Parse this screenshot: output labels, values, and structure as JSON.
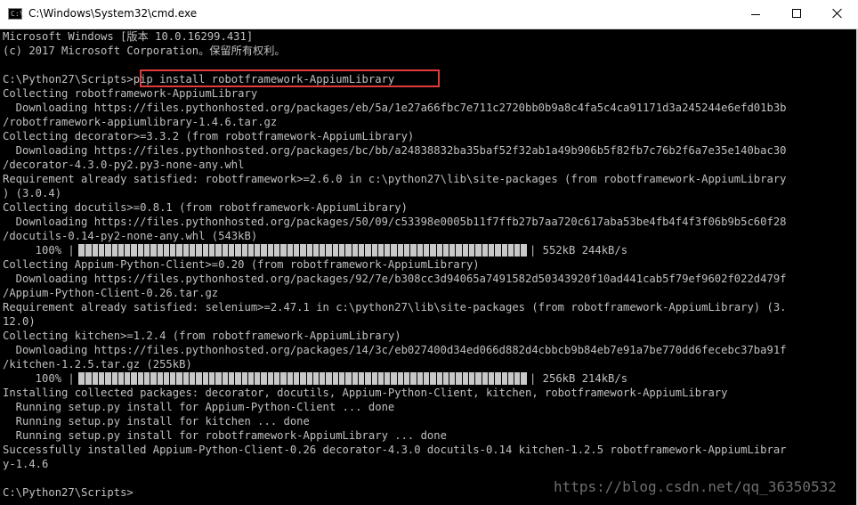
{
  "window": {
    "title": "C:\\Windows\\System32\\cmd.exe",
    "icon_text": "C:\\",
    "controls": [
      "minimize-icon",
      "maximize-icon",
      "close-icon"
    ]
  },
  "console": {
    "lines": [
      "Microsoft Windows [版本 10.0.16299.431]",
      "(c) 2017 Microsoft Corporation。保留所有权利。",
      "",
      "C:\\Python27\\Scripts>pip install robotframework-AppiumLibrary",
      "Collecting robotframework-AppiumLibrary",
      "  Downloading https://files.pythonhosted.org/packages/eb/5a/1e27a66fbc7e711c2720bb0b9a8c4fa5c4ca91171d3a245244e6efd01b3b",
      "/robotframework-appiumlibrary-1.4.6.tar.gz",
      "Collecting decorator>=3.3.2 (from robotframework-AppiumLibrary)",
      "  Downloading https://files.pythonhosted.org/packages/bc/bb/a24838832ba35baf52f32ab1a49b906b5f82fb7c76b2f6a7e35e140bac30",
      "/decorator-4.3.0-py2.py3-none-any.whl",
      "Requirement already satisfied: robotframework>=2.6.0 in c:\\python27\\lib\\site-packages (from robotframework-AppiumLibrary",
      ") (3.0.4)",
      "Collecting docutils>=0.8.1 (from robotframework-AppiumLibrary)",
      "  Downloading https://files.pythonhosted.org/packages/50/09/c53398e0005b11f7ffb27b7aa720c617aba53be4fb4f4f3f06b9b5c60f28",
      "/docutils-0.14-py2-none-any.whl (543kB)",
      "     100% |",
      "Collecting Appium-Python-Client>=0.20 (from robotframework-AppiumLibrary)",
      "  Downloading https://files.pythonhosted.org/packages/92/7e/b308cc3d94065a7491582d50343920f10ad441cab5f79ef9602f022d479f",
      "/Appium-Python-Client-0.26.tar.gz",
      "Requirement already satisfied: selenium>=2.47.1 in c:\\python27\\lib\\site-packages (from robotframework-AppiumLibrary) (3.",
      "12.0)",
      "Collecting kitchen>=1.2.4 (from robotframework-AppiumLibrary)",
      "  Downloading https://files.pythonhosted.org/packages/14/3c/eb027400d34ed066d882d4cbbcb9b84eb7e91a7be770dd6fecebc37ba91f",
      "/kitchen-1.2.5.tar.gz (255kB)",
      "     100% |",
      "Installing collected packages: decorator, docutils, Appium-Python-Client, kitchen, robotframework-AppiumLibrary",
      "  Running setup.py install for Appium-Python-Client ... done",
      "  Running setup.py install for kitchen ... done",
      "  Running setup.py install for robotframework-AppiumLibrary ... done",
      "Successfully installed Appium-Python-Client-0.26 decorator-4.3.0 docutils-0.14 kitchen-1.2.5 robotframework-AppiumLibrar",
      "y-1.4.6",
      "",
      "C:\\Python27\\Scripts>"
    ],
    "progress": [
      {
        "percent": 100,
        "suffix": "| 552kB 244kB/s"
      },
      {
        "percent": 100,
        "suffix": "| 256kB 214kB/s"
      }
    ]
  },
  "watermark": "https://blog.csdn.net/qq_36350532",
  "colors": {
    "console_bg": "#000000",
    "console_fg": "#c0c0c0",
    "highlight_border": "#e23a3a",
    "progress_fill": "#c8c8c8"
  }
}
